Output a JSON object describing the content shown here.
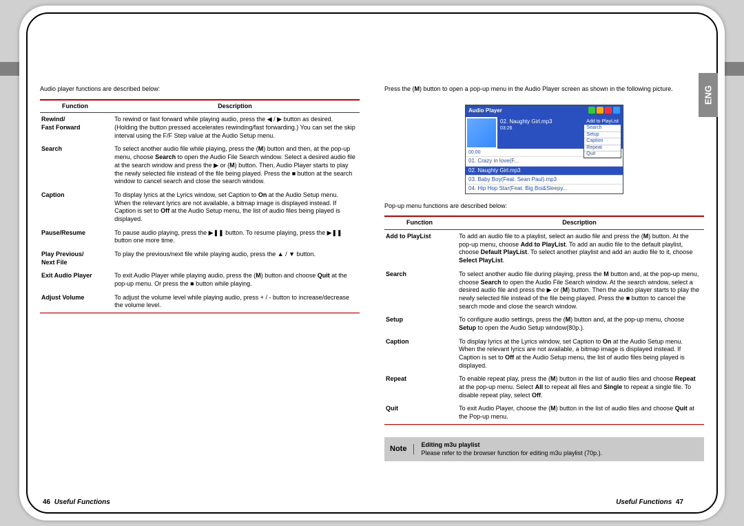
{
  "lang_tab": "ENG",
  "left": {
    "intro": "Audio player functions are described below:",
    "th_function": "Function",
    "th_description": "Description",
    "rows": {
      "r0": {
        "fn1": "Rewind/",
        "fn2": "Fast Forward",
        "desc": "To rewind or fast forward while playing audio, press the ◀ / ▶ button as desired. (Holding the button pressed accelerates rewinding/fast forwarding.) You can set the skip interval using the F/F Step value at the Audio Setup menu."
      },
      "r1": {
        "fn": "Search",
        "desc1": "To select another audio file while playing, press the (",
        "descM": "M",
        "desc2": ") button and then, at the pop-up menu, choose ",
        "descB": "Search",
        "desc3": " to open the Audio File Search window. Select a desired audio file at the search window and press the ▶ or (",
        "desc4": ") button. Then, Audio Player starts to play the newly selected file instead of the file being played. Press the ■ button at the search window to cancel search and close the search window."
      },
      "r2": {
        "fn": "Caption",
        "desc1": "To display lyrics at the Lyrics window, set Caption to ",
        "on": "On",
        "desc2": " at the Audio Setup menu. When the relevant lyrics are not available, a bitmap image is displayed instead. If Caption is set to ",
        "off": "Off",
        "desc3": " at the Audio Setup menu, the list of audio files being played is displayed."
      },
      "r3": {
        "fn": "Pause/Resume",
        "desc": "To pause audio playing, press the ▶❚❚ button. To resume playing, press the ▶❚❚ button one more time."
      },
      "r4": {
        "fn1": "Play Previous/",
        "fn2": "Next File",
        "desc": "To play the previous/next file while playing audio, press the ▲ / ▼ button."
      },
      "r5": {
        "fn": "Exit Audio Player",
        "desc1": "To exit Audio Player while playing audio, press the (",
        "m": "M",
        "desc2": ") button and choose ",
        "quit": "Quit",
        "desc3": " at the pop-up menu. Or press the ■ button while playing."
      },
      "r6": {
        "fn": "Adjust Volume",
        "desc": "To adjust the volume level while playing audio, press + / - button to increase/decrease the volume level."
      }
    },
    "footer_page": "46",
    "footer_title": "Useful Functions"
  },
  "right": {
    "intro1": "Press the (",
    "introM": "M",
    "intro2": ") button to open a pop-up menu in the Audio Player screen as shown in the following picture.",
    "intro3": "Pop-up menu functions are described below:",
    "th_function": "Function",
    "th_description": "Description",
    "rows": {
      "r0": {
        "fn": "Add to PlayList",
        "d1": "To add an audio file to a playlist, select an audio file and press the (",
        "m": "M",
        "d2": ") button. At the pop-up menu, choose ",
        "b1": "Add to PlayList",
        "d3": ". To add an audio file to the default playlist, choose ",
        "b2": "Default PlayList",
        "d4": ". To select another playlist and add an audio file to it, choose ",
        "b3": "Select PlayList",
        "d5": "."
      },
      "r1": {
        "fn": "Search",
        "d1": "To select another audio file during playing, press the ",
        "m": "M",
        "d2": " button and, at the pop-up menu, choose ",
        "b1": "Search",
        "d3": " to open the Audio File Search window. At the search window, select a desired audio file and press the ▶ or (",
        "d4": ") button. Then the audio player starts to play the newly selected file instead of the file being played. Press the ■ button to cancel the search mode and close the search window."
      },
      "r2": {
        "fn": "Setup",
        "d1": "To configure audio settings, press the (",
        "m": "M",
        "d2": ") button and, at the pop-up menu, choose ",
        "b1": "Setup",
        "d3": " to open the Audio Setup window(80p.)."
      },
      "r3": {
        "fn": "Caption",
        "d1": "To display lyrics at the Lyrics window, set Caption to ",
        "on": "On",
        "d2": " at the Audio Setup menu. When the relevant lyrics are not available, a bitmap image is displayed instead. If Caption is set to ",
        "off": "Off",
        "d3": " at the Audio Setup menu, the list of audio files being played is displayed."
      },
      "r4": {
        "fn": "Repeat",
        "d1": "To enable repeat play, press the (",
        "m": "M",
        "d2": ") button in the list of audio files and choose ",
        "b1": "Repeat",
        "d3": " at the pop-up menu. Select ",
        "b2": "All",
        "d4": " to repeat all files and ",
        "b3": "Single",
        "d5": " to repeat a single file. To disable repeat play, select ",
        "b4": "Off",
        "d6": "."
      },
      "r5": {
        "fn": "Quit",
        "d1": "To exit Audio Player, choose the (",
        "m": "M",
        "d2": ") button in the list of audio files and choose ",
        "b1": "Quit",
        "d3": " at the Pop-up menu."
      }
    },
    "note_label": "Note",
    "note_title": "Editing m3u playlist",
    "note_body": "Please refer to the browser function for editing m3u playlist (70p.).",
    "footer_title": "Useful Functions",
    "footer_page": "47"
  },
  "screenshot": {
    "title": "Audio Player",
    "now1": "02. Naughty Girl.mp3",
    "time": "03:26",
    "popup": {
      "p0": "Add to PlayList",
      "p1": "Search",
      "p2": "Setup",
      "p3": "Caption",
      "p4": "Repeat",
      "p5": "Quit"
    },
    "timebar": "00:00",
    "list": {
      "l0": "01. Crazy in love(F...",
      "l1": "02. Naughty Girl.mp3",
      "l2": "03. Baby Boy(Feat. Sean Paul).mp3",
      "l3": "04. Hip Hop Star(Feat. Big Boi&Sleepy..."
    }
  }
}
